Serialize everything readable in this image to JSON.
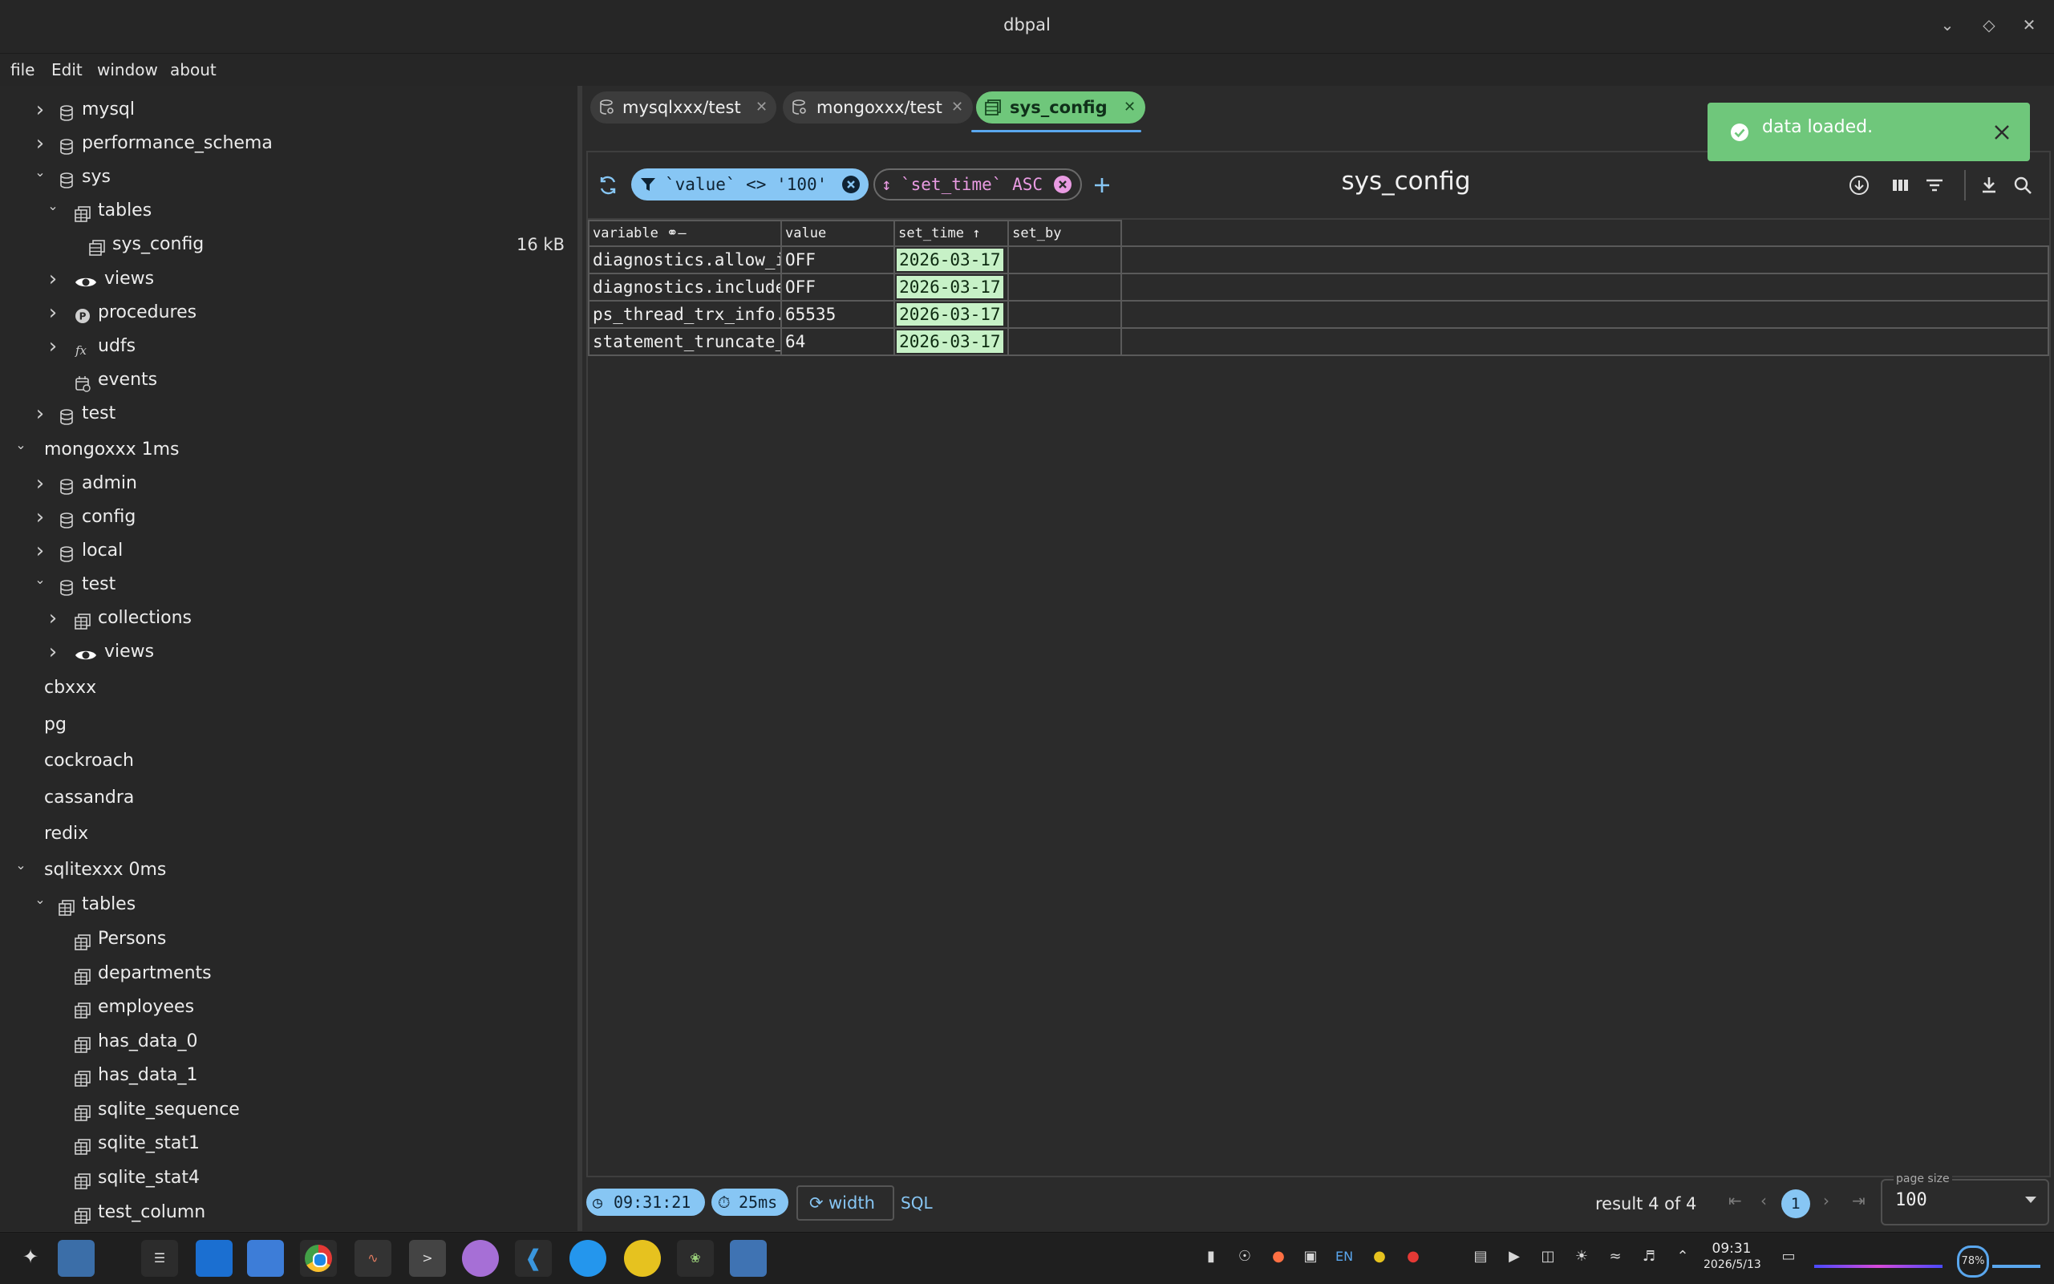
{
  "window": {
    "title": "dbpal"
  },
  "menu": [
    "file",
    "Edit",
    "window",
    "about"
  ],
  "sidebar": {
    "rows": [
      {
        "label": "mysql",
        "indent": 1,
        "chevron": "right",
        "icon": "database-icon"
      },
      {
        "label": "performance_schema",
        "indent": 1,
        "chevron": "right",
        "icon": "database-icon"
      },
      {
        "label": "sys",
        "indent": 1,
        "chevron": "down",
        "icon": "database-icon"
      },
      {
        "label": "tables",
        "indent": 2,
        "chevron": "down",
        "icon": "tables-icon"
      },
      {
        "label": "sys_config",
        "indent": 3,
        "chevron": "none",
        "icon": "table-icon",
        "size": "16 kB"
      },
      {
        "label": "views",
        "indent": 2,
        "chevron": "right",
        "icon": "eye-icon"
      },
      {
        "label": "procedures",
        "indent": 2,
        "chevron": "right",
        "icon": "procedure-icon"
      },
      {
        "label": "udfs",
        "indent": 2,
        "chevron": "right",
        "icon": "function-icon"
      },
      {
        "label": "events",
        "indent": 2,
        "chevron": "none",
        "icon": "calendar-icon"
      },
      {
        "label": "test",
        "indent": 1,
        "chevron": "right",
        "icon": "database-icon"
      },
      {
        "label": "mongoxxx 1ms",
        "indent": 0,
        "chevron": "down",
        "icon": "none"
      },
      {
        "label": "admin",
        "indent": 1,
        "chevron": "right",
        "icon": "database-icon"
      },
      {
        "label": "config",
        "indent": 1,
        "chevron": "right",
        "icon": "database-icon"
      },
      {
        "label": "local",
        "indent": 1,
        "chevron": "right",
        "icon": "database-icon"
      },
      {
        "label": "test",
        "indent": 1,
        "chevron": "down",
        "icon": "database-icon"
      },
      {
        "label": "collections",
        "indent": 2,
        "chevron": "right",
        "icon": "tables-icon"
      },
      {
        "label": "views",
        "indent": 2,
        "chevron": "right",
        "icon": "eye-icon"
      },
      {
        "label": "cbxxx",
        "indent": 0,
        "chevron": "none",
        "icon": "none"
      },
      {
        "label": "pg",
        "indent": 0,
        "chevron": "none",
        "icon": "none"
      },
      {
        "label": "cockroach",
        "indent": 0,
        "chevron": "none",
        "icon": "none"
      },
      {
        "label": "cassandra",
        "indent": 0,
        "chevron": "none",
        "icon": "none"
      },
      {
        "label": "redix",
        "indent": 0,
        "chevron": "none",
        "icon": "none"
      },
      {
        "label": "sqlitexxx 0ms",
        "indent": 0,
        "chevron": "down",
        "icon": "none"
      },
      {
        "label": "tables",
        "indent": 1,
        "chevron": "down",
        "icon": "tables-icon"
      },
      {
        "label": "Persons",
        "indent": 2,
        "chevron": "none",
        "icon": "tables-icon"
      },
      {
        "label": "departments",
        "indent": 2,
        "chevron": "none",
        "icon": "tables-icon"
      },
      {
        "label": "employees",
        "indent": 2,
        "chevron": "none",
        "icon": "tables-icon"
      },
      {
        "label": "has_data_0",
        "indent": 2,
        "chevron": "none",
        "icon": "tables-icon"
      },
      {
        "label": "has_data_1",
        "indent": 2,
        "chevron": "none",
        "icon": "tables-icon"
      },
      {
        "label": "sqlite_sequence",
        "indent": 2,
        "chevron": "none",
        "icon": "tables-icon"
      },
      {
        "label": "sqlite_stat1",
        "indent": 2,
        "chevron": "none",
        "icon": "tables-icon"
      },
      {
        "label": "sqlite_stat4",
        "indent": 2,
        "chevron": "none",
        "icon": "tables-icon"
      },
      {
        "label": "test_column",
        "indent": 2,
        "chevron": "none",
        "icon": "tables-icon"
      }
    ]
  },
  "tabs": [
    {
      "label": "mysqlxxx/test",
      "active": false
    },
    {
      "label": "mongoxxx/test",
      "active": false
    },
    {
      "label": "sys_config",
      "active": true
    }
  ],
  "toolbar": {
    "filter_chip": "`value` <> '100'",
    "sort_chip": "`set_time` ASC",
    "title": "sys_config"
  },
  "table": {
    "columns": [
      "variable",
      "value",
      "set_time",
      "set_by"
    ],
    "rows": [
      [
        "diagnostics.allow_i",
        "OFF",
        "2026-03-17",
        ""
      ],
      [
        "diagnostics.include",
        "OFF",
        "2026-03-17",
        ""
      ],
      [
        "ps_thread_trx_info.",
        "65535",
        "2026-03-17",
        ""
      ],
      [
        "statement_truncate_",
        "64",
        "2026-03-17",
        ""
      ]
    ]
  },
  "footer": {
    "time": "09:31:21",
    "duration": "25ms",
    "width_button": "width",
    "sql_link": "SQL",
    "result": "result 4 of 4",
    "current_page": "1",
    "page_size_label": "page size",
    "page_size": "100"
  },
  "toast": {
    "message": "data loaded."
  },
  "taskbar": {
    "lang": "EN",
    "time": "09:31",
    "date": "2026/5/13",
    "battery": "78%"
  },
  "colors": {
    "accent_green": "#6fc77b",
    "accent_blue": "#87c6f4",
    "date_cell": "#c7f1c7",
    "sort_pink": "#e99be2"
  }
}
